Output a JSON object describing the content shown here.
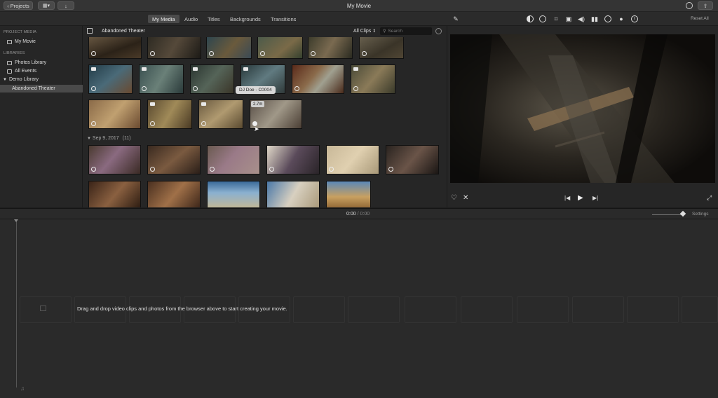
{
  "titlebar": {
    "projects_label": "Projects",
    "app_title": "My Movie"
  },
  "tabs": [
    {
      "label": "My Media",
      "active": true
    },
    {
      "label": "Audio",
      "active": false
    },
    {
      "label": "Titles",
      "active": false
    },
    {
      "label": "Backgrounds",
      "active": false
    },
    {
      "label": "Transitions",
      "active": false
    }
  ],
  "adjust": {
    "reset_all_label": "Reset All",
    "tools": [
      "color-balance-icon",
      "color-correction-icon",
      "crop-icon",
      "stabilization-icon",
      "volume-icon",
      "noise-reduction-icon",
      "speed-icon",
      "clip-filter-icon",
      "info-icon"
    ]
  },
  "sidebar": {
    "project_media_heading": "PROJECT MEDIA",
    "project_item": "My Movie",
    "libraries_heading": "LIBRARIES",
    "items": [
      {
        "label": "Photos Library"
      },
      {
        "label": "All Events"
      },
      {
        "label": "Demo Library"
      },
      {
        "label": "Abandoned Theater"
      }
    ]
  },
  "browser": {
    "event_title": "Abandoned Theater",
    "filter_label": "All Clips",
    "search_placeholder": "Search",
    "date_label": "Sep 9, 2017",
    "date_count": "(11)",
    "tooltip": "DJ Doe - C0004",
    "duration": "2.7m"
  },
  "timeline": {
    "timecode_current": "0:00",
    "timecode_sep": "/",
    "timecode_total": "0:00",
    "settings_label": "Settings",
    "drop_hint": "Drag and drop video clips and photos from the browser above to start creating your movie."
  },
  "colors": {
    "background": "#1e1e1e",
    "panel": "#262626",
    "selected": "#4a4a4a"
  }
}
